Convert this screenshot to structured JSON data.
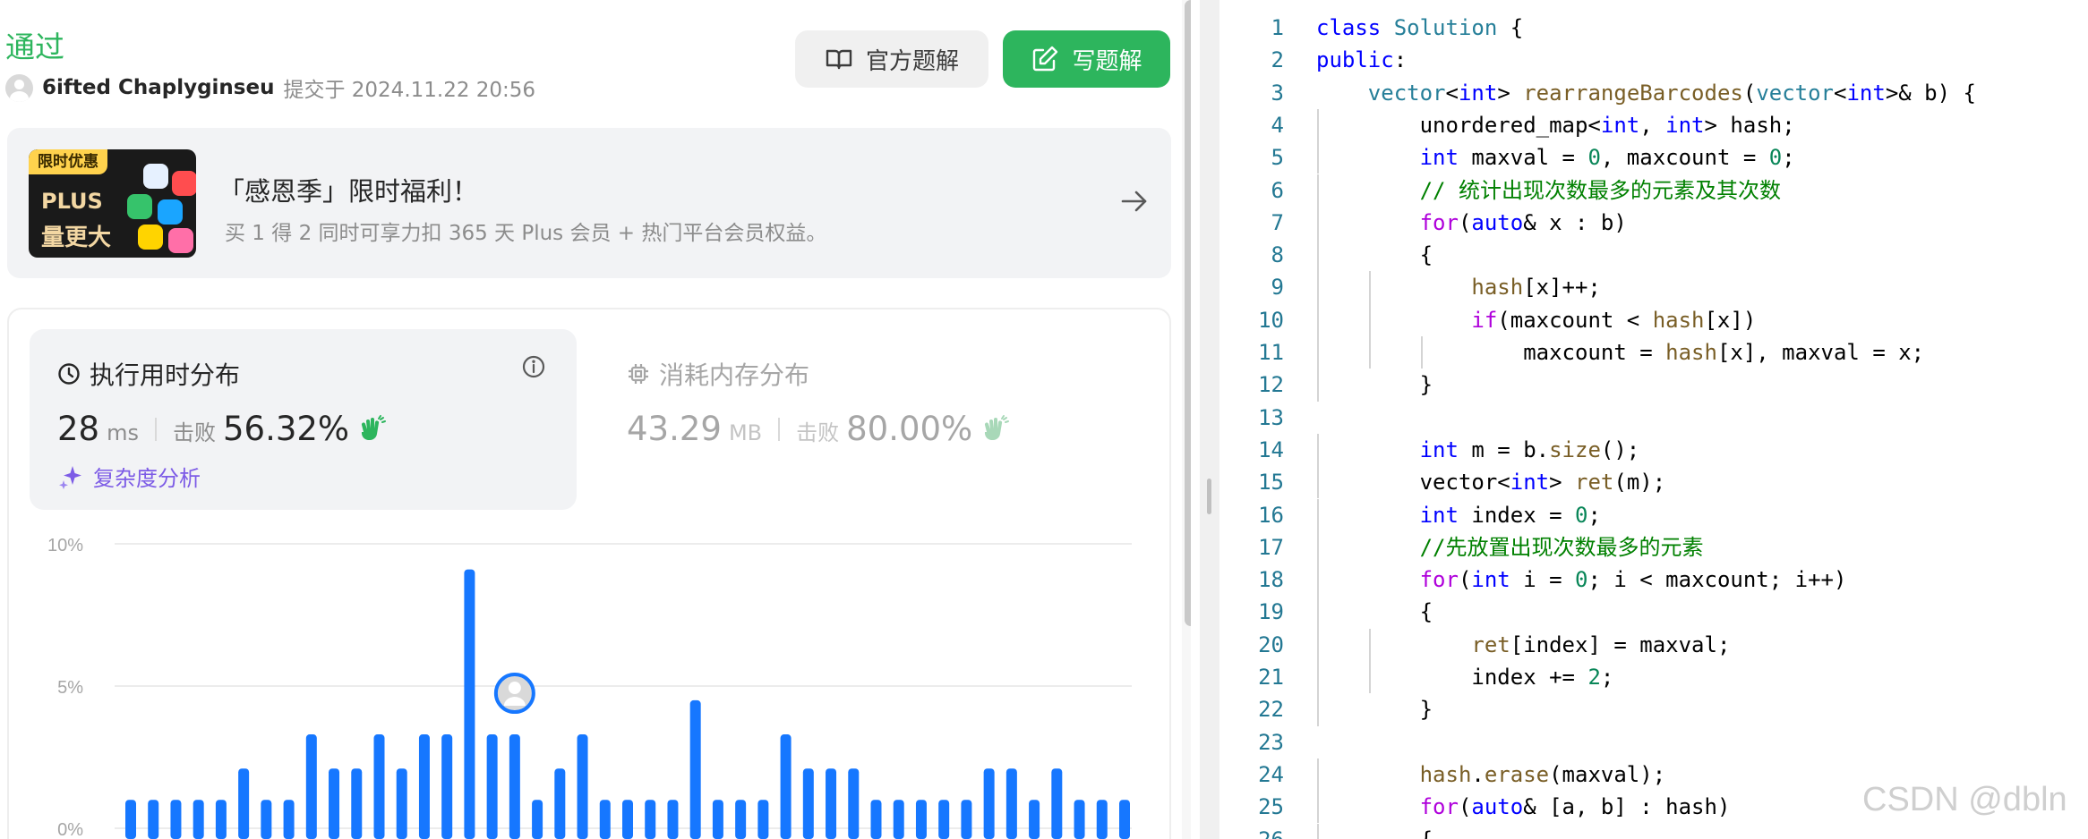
{
  "submission": {
    "status": "通过",
    "author": "6ifted Chaplyginseu",
    "submitted_text": "提交于 2024.11.22 20:56"
  },
  "buttons": {
    "official_solution": "官方题解",
    "write_solution": "写题解"
  },
  "promo": {
    "tag": "限时优惠",
    "plus": "PLUS",
    "badge_text": "量更大",
    "title": "「感恩季」限时福利！",
    "subtitle": "买 1 得 2 同时可享力扣 365 天 Plus 会员 + 热门平台会员权益。"
  },
  "runtime": {
    "title": "执行用时分布",
    "value": "28",
    "unit": "ms",
    "beat_label": "击败",
    "beat_percent": "56.32%",
    "analysis_link": "复杂度分析"
  },
  "memory": {
    "title": "消耗内存分布",
    "value": "43.29",
    "unit": "MB",
    "beat_label": "击败",
    "beat_percent": "80.00%"
  },
  "chart_data": {
    "type": "bar",
    "y_tick_labels": [
      "10%",
      "5%",
      "0%"
    ],
    "ylim": [
      0,
      10
    ],
    "values": [
      1,
      1,
      1,
      1,
      1,
      2.1,
      1,
      1,
      3.3,
      2.1,
      2.1,
      3.3,
      2.1,
      3.3,
      3.3,
      9.1,
      3.3,
      3.3,
      1,
      2.1,
      3.3,
      1,
      1,
      1,
      1,
      4.5,
      1,
      1,
      1,
      3.3,
      2.1,
      2.1,
      2.1,
      1,
      1,
      1,
      1,
      1,
      2.1,
      2.1,
      1,
      2.1,
      1,
      1,
      1
    ],
    "highlight_index": 17,
    "bar_color": "#1677ff",
    "grid": true
  },
  "colors": {
    "accent_green": "#2db55d",
    "bar_blue": "#1677ff",
    "complexity_purple": "#7d5ce6"
  },
  "code": {
    "lines": [
      [
        [
          "kw",
          "class "
        ],
        [
          "ty",
          "Solution"
        ],
        [
          "p",
          " {"
        ]
      ],
      [
        [
          "kw",
          "public"
        ],
        [
          "p",
          ":"
        ]
      ],
      [
        [
          "p",
          "    "
        ],
        [
          "ty",
          "vector"
        ],
        [
          "p",
          "<"
        ],
        [
          "kw",
          "int"
        ],
        [
          "p",
          "> "
        ],
        [
          "fn",
          "rearrangeBarcodes"
        ],
        [
          "p",
          "("
        ],
        [
          "ty",
          "vector"
        ],
        [
          "p",
          "<"
        ],
        [
          "kw",
          "int"
        ],
        [
          "p",
          ">& b) {"
        ]
      ],
      [
        [
          "p",
          "        unordered_map<"
        ],
        [
          "kw",
          "int"
        ],
        [
          "p",
          ", "
        ],
        [
          "kw",
          "int"
        ],
        [
          "p",
          "> hash;"
        ]
      ],
      [
        [
          "p",
          "        "
        ],
        [
          "kw",
          "int"
        ],
        [
          "p",
          " maxval = "
        ],
        [
          "num",
          "0"
        ],
        [
          "p",
          ", maxcount = "
        ],
        [
          "num",
          "0"
        ],
        [
          "p",
          ";"
        ]
      ],
      [
        [
          "p",
          "        "
        ],
        [
          "cm",
          "// 统计出现次数最多的元素及其次数"
        ]
      ],
      [
        [
          "p",
          "        "
        ],
        [
          "ctl",
          "for"
        ],
        [
          "p",
          "("
        ],
        [
          "kw",
          "auto"
        ],
        [
          "p",
          "& x : b)"
        ]
      ],
      [
        [
          "p",
          "        {"
        ]
      ],
      [
        [
          "p",
          "            "
        ],
        [
          "fn",
          "hash"
        ],
        [
          "p",
          "[x]++;"
        ]
      ],
      [
        [
          "p",
          "            "
        ],
        [
          "ctl",
          "if"
        ],
        [
          "p",
          "(maxcount < "
        ],
        [
          "fn",
          "hash"
        ],
        [
          "p",
          "[x])"
        ]
      ],
      [
        [
          "p",
          "                maxcount = "
        ],
        [
          "fn",
          "hash"
        ],
        [
          "p",
          "[x], maxval = x;"
        ]
      ],
      [
        [
          "p",
          "        }"
        ]
      ],
      [
        [
          "p",
          ""
        ]
      ],
      [
        [
          "p",
          "        "
        ],
        [
          "kw",
          "int"
        ],
        [
          "p",
          " m = b."
        ],
        [
          "fn",
          "size"
        ],
        [
          "p",
          "();"
        ]
      ],
      [
        [
          "p",
          "        vector<"
        ],
        [
          "kw",
          "int"
        ],
        [
          "p",
          "> "
        ],
        [
          "fn",
          "ret"
        ],
        [
          "p",
          "(m);"
        ]
      ],
      [
        [
          "p",
          "        "
        ],
        [
          "kw",
          "int"
        ],
        [
          "p",
          " index = "
        ],
        [
          "num",
          "0"
        ],
        [
          "p",
          ";"
        ]
      ],
      [
        [
          "p",
          "        "
        ],
        [
          "cm",
          "//先放置出现次数最多的元素"
        ]
      ],
      [
        [
          "p",
          "        "
        ],
        [
          "ctl",
          "for"
        ],
        [
          "p",
          "("
        ],
        [
          "kw",
          "int"
        ],
        [
          "p",
          " i = "
        ],
        [
          "num",
          "0"
        ],
        [
          "p",
          "; i < maxcount; i++)"
        ]
      ],
      [
        [
          "p",
          "        {"
        ]
      ],
      [
        [
          "p",
          "            "
        ],
        [
          "fn",
          "ret"
        ],
        [
          "p",
          "[index] = maxval;"
        ]
      ],
      [
        [
          "p",
          "            index += "
        ],
        [
          "num",
          "2"
        ],
        [
          "p",
          ";"
        ]
      ],
      [
        [
          "p",
          "        }"
        ]
      ],
      [
        [
          "p",
          ""
        ]
      ],
      [
        [
          "p",
          "        "
        ],
        [
          "fn",
          "hash"
        ],
        [
          "p",
          "."
        ],
        [
          "fn",
          "erase"
        ],
        [
          "p",
          "(maxval);"
        ]
      ],
      [
        [
          "p",
          "        "
        ],
        [
          "ctl",
          "for"
        ],
        [
          "p",
          "("
        ],
        [
          "kw",
          "auto"
        ],
        [
          "p",
          "& [a, b] : hash)"
        ]
      ],
      [
        [
          "p",
          "        {"
        ]
      ]
    ]
  },
  "watermark": "CSDN @dbln"
}
